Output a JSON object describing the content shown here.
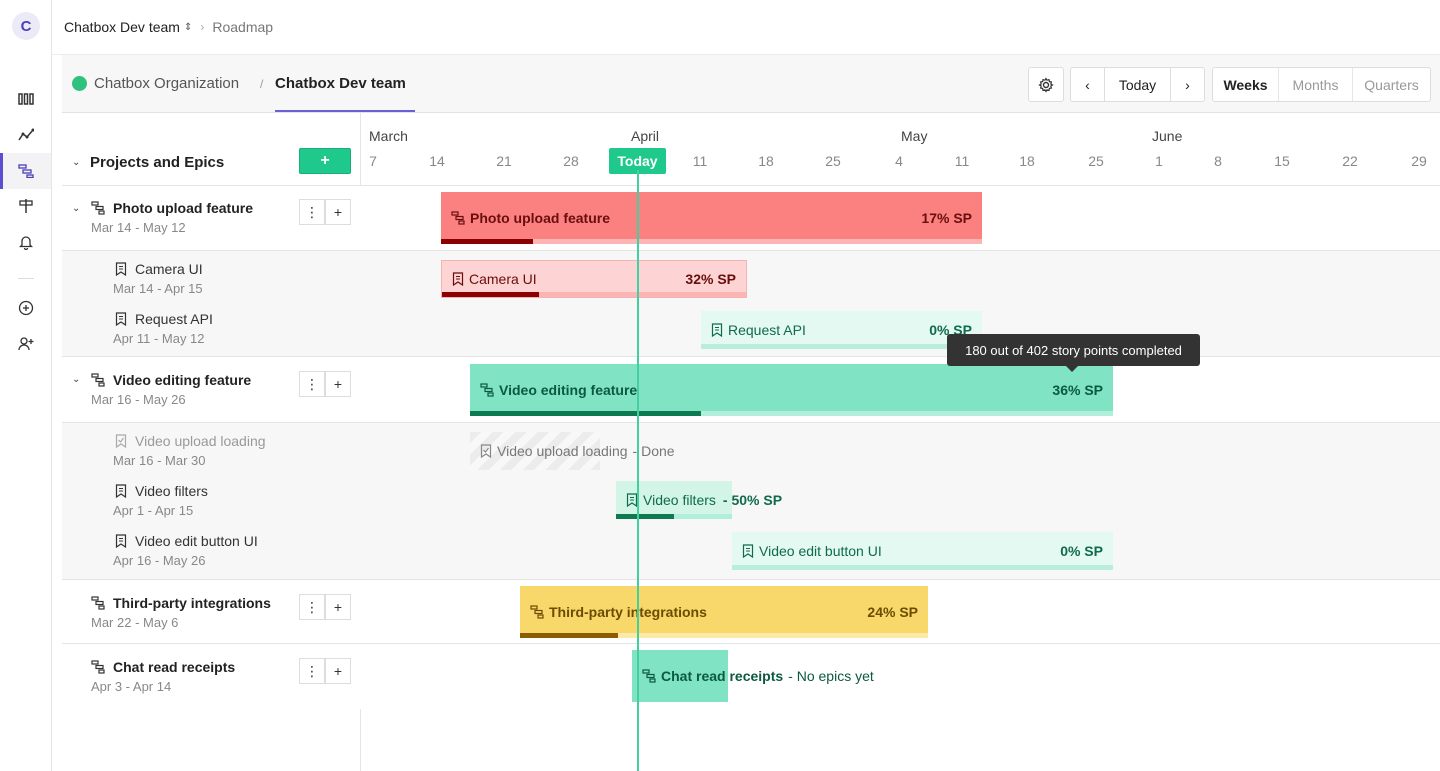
{
  "rail": {
    "logo": "C"
  },
  "topbar": {
    "team": "Chatbox Dev team",
    "roadmap": "Roadmap"
  },
  "subhead": {
    "org": "Chatbox Organization",
    "team": "Chatbox Dev team",
    "today": "Today",
    "views": [
      "Weeks",
      "Months",
      "Quarters"
    ],
    "active_view": "Weeks"
  },
  "panel": {
    "title": "Projects and Epics",
    "add_label": "+",
    "projects": [
      {
        "name": "Photo upload feature",
        "dates": "Mar 14 - May 12",
        "epics": [
          {
            "name": "Camera UI",
            "dates": "Mar 14 - Apr 15"
          },
          {
            "name": "Request API",
            "dates": "Apr 11 - May 12"
          }
        ]
      },
      {
        "name": "Video editing feature",
        "dates": "Mar 16 - May 26",
        "epics": [
          {
            "name": "Video upload loading",
            "dates": "Mar 16 - Mar 30"
          },
          {
            "name": "Video filters",
            "dates": "Apr 1 - Apr 15"
          },
          {
            "name": "Video edit button UI",
            "dates": "Apr 16 - May 26"
          }
        ]
      },
      {
        "name": "Third-party integrations",
        "dates": "Mar 22 - May 6",
        "epics": []
      },
      {
        "name": "Chat read receipts",
        "dates": "Apr 3 - Apr 14",
        "epics": []
      }
    ]
  },
  "timeline": {
    "months": [
      "March",
      "April",
      "May",
      "June"
    ],
    "days": [
      "7",
      "14",
      "21",
      "28",
      "4",
      "11",
      "18",
      "25",
      "4",
      "11",
      "18",
      "25",
      "1",
      "8",
      "15",
      "22",
      "29"
    ],
    "today_label": "Today",
    "bars": {
      "photo": {
        "label": "Photo upload feature",
        "pct": "17% SP",
        "progress": 0.17
      },
      "camera": {
        "label": "Camera UI",
        "pct": "32% SP",
        "progress": 0.32
      },
      "request": {
        "label": "Request API",
        "pct": "0% SP",
        "progress": 0
      },
      "video": {
        "label": "Video editing feature",
        "pct": "36% SP",
        "progress": 0.36
      },
      "upload_loading": {
        "label": "Video upload loading",
        "suffix": "- Done"
      },
      "filters": {
        "label": "Video filters",
        "pct": "- 50% SP",
        "progress": 0.5
      },
      "edit_button": {
        "label": "Video edit button UI",
        "pct": "0% SP",
        "progress": 0
      },
      "thirdparty": {
        "label": "Third-party integrations",
        "pct": "24% SP",
        "progress": 0.24
      },
      "receipts": {
        "label": "Chat read receipts",
        "suffix": "- No epics yet"
      }
    },
    "tooltip": "180 out of 402 story points completed"
  },
  "colors": {
    "accent": "#1fc98b",
    "red_bar": "#fb8181",
    "green_bar": "#7fe3c4",
    "yellow_bar": "#f8d86a"
  }
}
